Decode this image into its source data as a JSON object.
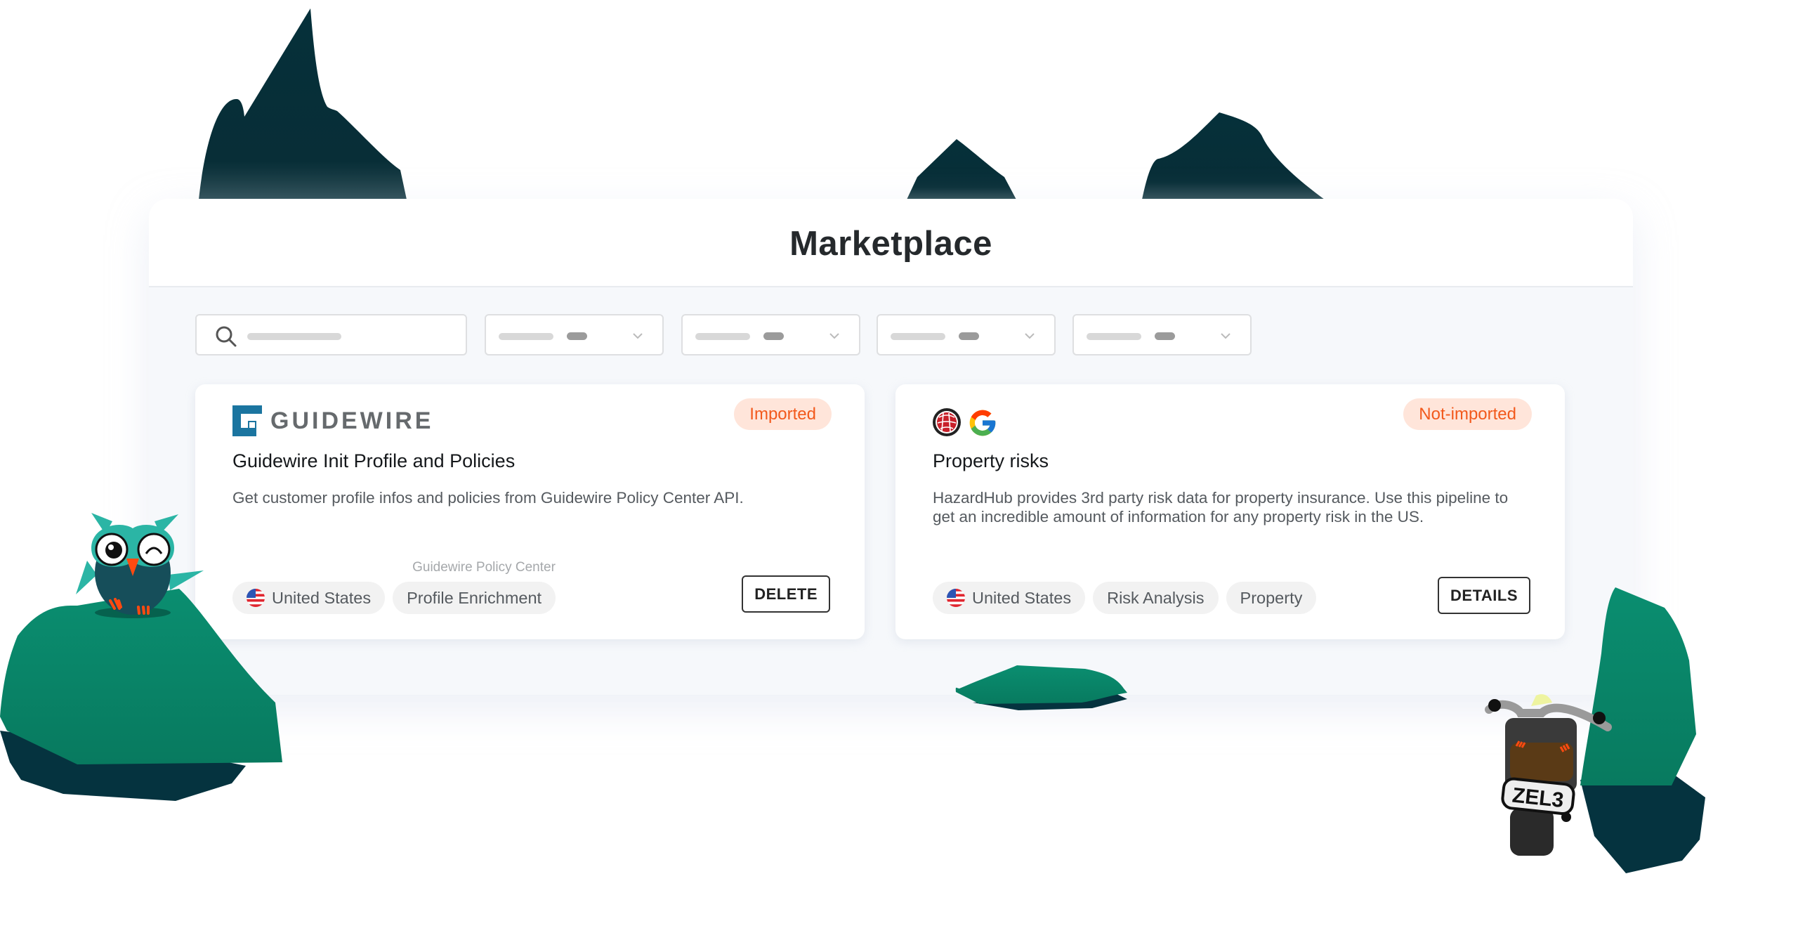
{
  "page": {
    "title": "Marketplace"
  },
  "filters": {
    "search_placeholder": "",
    "dropdowns": [
      {
        "label": "",
        "value": ""
      },
      {
        "label": "",
        "value": ""
      },
      {
        "label": "",
        "value": ""
      },
      {
        "label": "",
        "value": ""
      }
    ]
  },
  "cards": [
    {
      "logo_text": "GUIDEWIRE",
      "status": "Imported",
      "title": "Guidewire Init Profile and Policies",
      "description": "Get customer profile infos and policies from Guidewire Policy Center API.",
      "tags": [
        {
          "label": "United States",
          "icon": "us-flag-icon"
        },
        {
          "label": "Profile Enrichment",
          "hint": "Guidewire Policy Center"
        }
      ],
      "action_label": "DELETE"
    },
    {
      "logo_text": "",
      "status": "Not-imported",
      "title": "Property risks",
      "description": "HazardHub provides 3rd party risk data for property insurance. Use this pipeline to get an incredible amount of information for any property risk in the US.",
      "tags": [
        {
          "label": "United States",
          "icon": "us-flag-icon"
        },
        {
          "label": "Risk Analysis"
        },
        {
          "label": "Property"
        }
      ],
      "action_label": "DETAILS"
    }
  ],
  "illustration": {
    "motorcycle_plate": "ZEL3"
  },
  "colors": {
    "badge_bg": "#FFE5DA",
    "badge_text": "#F2591C",
    "rock_green": "#0A8A6C",
    "rock_dark": "#05333F",
    "guidewire_blue": "#1B75A0"
  }
}
